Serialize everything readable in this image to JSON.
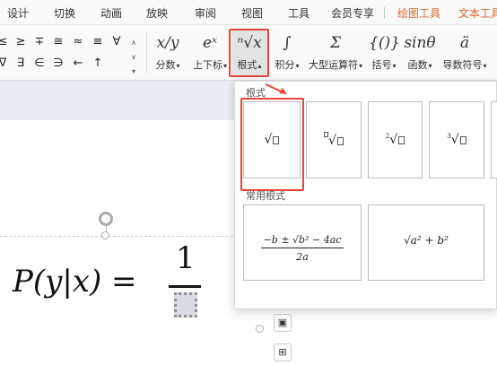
{
  "menu": {
    "tabs": [
      "设计",
      "切换",
      "动画",
      "放映",
      "审阅",
      "视图",
      "工具",
      "会员专享"
    ],
    "context_tabs": [
      "绘图工具",
      "文本工具"
    ]
  },
  "symbols": [
    "≤",
    "≥",
    "∓",
    "≅",
    "≈",
    "≡",
    "∀",
    "∇",
    "∃",
    "∈",
    "∋",
    "←",
    "↑"
  ],
  "ribbon": {
    "fraction": {
      "icon": "x/y",
      "label": "分数"
    },
    "script": {
      "icon": "eˣ",
      "label": "上下标"
    },
    "radical": {
      "icon": "ⁿ√x",
      "label": "根式"
    },
    "integral": {
      "icon": "∫",
      "label": "积分"
    },
    "large_operator": {
      "icon": "Σ",
      "label": "大型运算符"
    },
    "bracket": {
      "icon": "{()}",
      "label": "括号"
    },
    "function": {
      "icon": "sinθ",
      "label": "函数"
    },
    "accent": {
      "icon": "ä",
      "label": "导数符号"
    }
  },
  "panel": {
    "section_radicals": "根式",
    "section_common": "常用根式",
    "common_quadratic": {
      "num": "−b ± √b² − 4ac",
      "den": "2a"
    },
    "common_hypot": "√a² + b²"
  },
  "formula": {
    "lhs": "P(y|x) =",
    "numerator": "1"
  },
  "colors": {
    "highlight": "#e5453a",
    "context_tab": "#e0662a"
  }
}
